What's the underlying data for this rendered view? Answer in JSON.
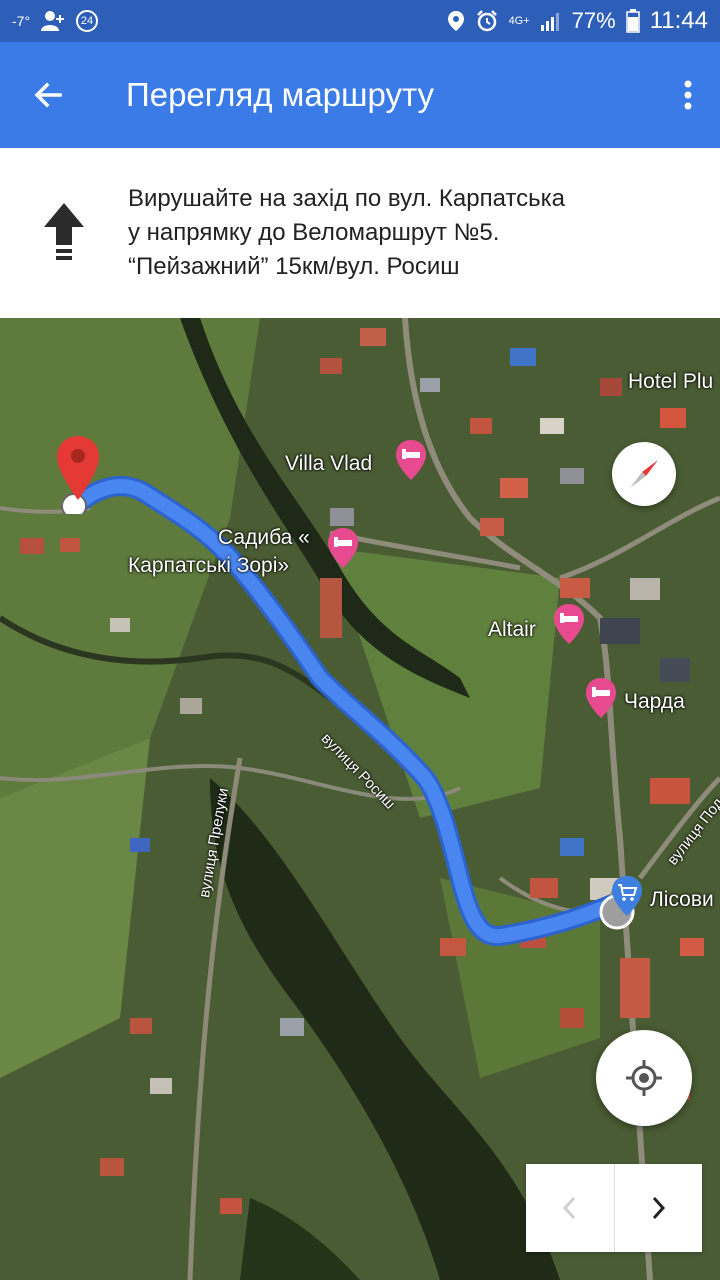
{
  "status_bar": {
    "temperature": "-7°",
    "badge_count": "24",
    "network": "4G+",
    "battery_percent": "77%",
    "time": "11:44"
  },
  "app_bar": {
    "title": "Перегляд маршруту",
    "back_icon": "arrow-back-icon",
    "menu_icon": "more-vert-icon"
  },
  "instruction": {
    "direction_icon": "arrow-up-icon",
    "line1": "Вирушайте на захід по вул. Карпатська",
    "line2": "у напрямку до Веломаршрут №5.",
    "line3": "“Пейзажний” 15км/вул. Росиш"
  },
  "map": {
    "route_color": "#4a86f0",
    "poi": [
      {
        "label": "Hotel Plu"
      },
      {
        "label": "Villa Vlad"
      },
      {
        "label": "Садиба «"
      },
      {
        "label": "Карпатські Зорі»"
      },
      {
        "label": "Altair"
      },
      {
        "label": "Чарда"
      },
      {
        "label": "Лісови"
      }
    ],
    "roads": [
      {
        "label": "вулиця Росиш"
      },
      {
        "label": "вулиця Прелуки"
      },
      {
        "label": "вулиця Под"
      }
    ],
    "poi_color": "#e84a8f",
    "destination_pin_color": "#e53935"
  }
}
